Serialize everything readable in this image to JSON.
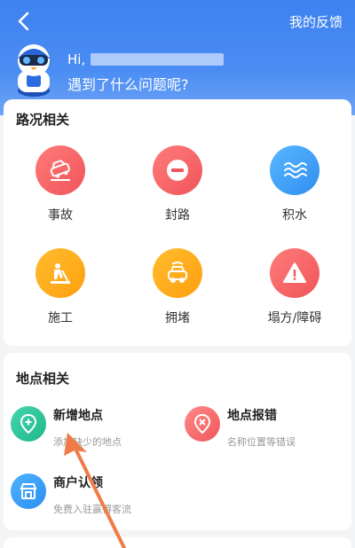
{
  "header": {
    "feedback_label": "我的反馈",
    "greeting": "Hi,",
    "question": "遇到了什么问题呢?"
  },
  "road": {
    "title": "路况相关",
    "items": [
      {
        "label": "事故",
        "icon": "accident-car-icon"
      },
      {
        "label": "封路",
        "icon": "road-closed-icon"
      },
      {
        "label": "积水",
        "icon": "water-icon"
      },
      {
        "label": "施工",
        "icon": "construction-worker-icon"
      },
      {
        "label": "拥堵",
        "icon": "traffic-jam-icon"
      },
      {
        "label": "塌方/障碍",
        "icon": "warning-icon"
      }
    ]
  },
  "place": {
    "title": "地点相关",
    "items": [
      {
        "title": "新增地点",
        "subtitle": "添加缺少的地点",
        "icon": "location-plus-icon"
      },
      {
        "title": "地点报错",
        "subtitle": "名称位置等错误",
        "icon": "location-error-icon"
      },
      {
        "title": "商户认领",
        "subtitle": "免费入驻赢得客流",
        "icon": "shop-icon"
      }
    ]
  },
  "colors": {
    "header_blue": "#4a8cf3",
    "red": "#f0555a",
    "blue": "#2f8ff0",
    "orange": "#ff9f0f",
    "green": "#1fb889",
    "annotation_arrow": "#f07a48"
  }
}
